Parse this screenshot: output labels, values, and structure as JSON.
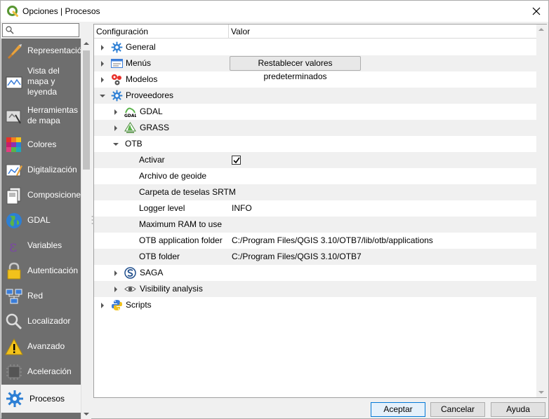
{
  "window": {
    "title": "Opciones | Procesos",
    "close_icon": "close-icon"
  },
  "search": {
    "placeholder": "",
    "value": ""
  },
  "sidebar": {
    "items": [
      {
        "label": "Representación",
        "icon": "paintbrush-icon"
      },
      {
        "label": "Vista del mapa y leyenda",
        "icon": "map-view-icon"
      },
      {
        "label": "Herramientas de mapa",
        "icon": "map-tools-icon"
      },
      {
        "label": "Colores",
        "icon": "color-grid-icon"
      },
      {
        "label": "Digitalización",
        "icon": "digitizing-icon"
      },
      {
        "label": "Composiciones",
        "icon": "layouts-icon"
      },
      {
        "label": "GDAL",
        "icon": "globe-icon"
      },
      {
        "label": "Variables",
        "icon": "epsilon-icon"
      },
      {
        "label": "Autenticación",
        "icon": "lock-icon"
      },
      {
        "label": "Red",
        "icon": "network-icon"
      },
      {
        "label": "Localizador",
        "icon": "search-icon"
      },
      {
        "label": "Avanzado",
        "icon": "warning-icon"
      },
      {
        "label": "Aceleración",
        "icon": "chip-icon"
      },
      {
        "label": "Procesos",
        "icon": "gear-icon",
        "selected": true
      }
    ]
  },
  "tree": {
    "columns": [
      "Configuración",
      "Valor"
    ],
    "rows": [
      {
        "label": "General",
        "icon": "gear-icon",
        "expanded": false
      },
      {
        "label": "Menús",
        "icon": "menu-icon",
        "expanded": false,
        "button": "Restablecer valores predeterminados"
      },
      {
        "label": "Modelos",
        "icon": "models-icon",
        "expanded": false
      },
      {
        "label": "Proveedores",
        "icon": "gear-icon",
        "expanded": true
      },
      {
        "label": "GDAL",
        "icon": "gdal-icon",
        "expanded": false
      },
      {
        "label": "GRASS",
        "icon": "grass-icon",
        "expanded": false
      },
      {
        "label": "OTB",
        "expanded": true
      },
      {
        "label": "Activar",
        "checked": true
      },
      {
        "label": "Archivo de geoide",
        "value": ""
      },
      {
        "label": "Carpeta de teselas SRTM",
        "value": ""
      },
      {
        "label": "Logger level",
        "value": "INFO"
      },
      {
        "label": "Maximum RAM to use",
        "value": ""
      },
      {
        "label": "OTB application folder",
        "value": "C:/Program Files/QGIS 3.10/OTB7/lib/otb/applications"
      },
      {
        "label": "OTB folder",
        "value": "C:/Program Files/QGIS 3.10/OTB7"
      },
      {
        "label": "SAGA",
        "icon": "saga-icon",
        "expanded": false
      },
      {
        "label": "Visibility analysis",
        "icon": "eye-icon",
        "expanded": false
      },
      {
        "label": "Scripts",
        "icon": "python-icon",
        "expanded": false
      }
    ]
  },
  "buttons": {
    "accept": "Aceptar",
    "cancel": "Cancelar",
    "help": "Ayuda"
  },
  "colors": {
    "sidebar_bg": "#6e6e6e",
    "qgis_green": "#589632",
    "selection_bg": "#f2f2f2",
    "primary_border": "#0078d7"
  }
}
